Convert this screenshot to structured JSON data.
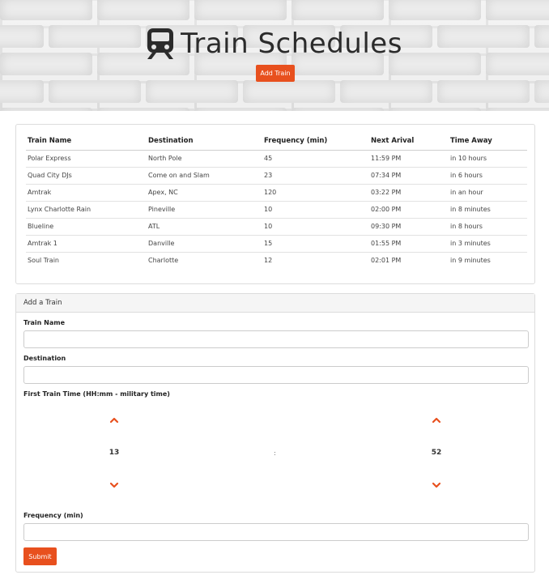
{
  "header": {
    "title": "Train Schedules",
    "icon": "train-icon",
    "add_train_label": "Add Train"
  },
  "schedule": {
    "columns": [
      "Train Name",
      "Destination",
      "Frequency (min)",
      "Next Arival",
      "Time Away"
    ],
    "rows": [
      [
        "Polar Express",
        "North Pole",
        "45",
        "11:59 PM",
        "in 10 hours"
      ],
      [
        "Quad City DJs",
        "Come on and Slam",
        "23",
        "07:34 PM",
        "in 6 hours"
      ],
      [
        "Amtrak",
        "Apex, NC",
        "120",
        "03:22 PM",
        "in an hour"
      ],
      [
        "Lynx Charlotte Rain",
        "Pineville",
        "10",
        "02:00 PM",
        "in 8 minutes"
      ],
      [
        "Blueline",
        "ATL",
        "10",
        "09:30 PM",
        "in 8 hours"
      ],
      [
        "Amtrak 1",
        "Danville",
        "15",
        "01:55 PM",
        "in 3 minutes"
      ],
      [
        "Soul Train",
        "Charlotte",
        "12",
        "02:01 PM",
        "in 9 minutes"
      ]
    ]
  },
  "form": {
    "heading": "Add a Train",
    "train_name_label": "Train Name",
    "train_name_value": "",
    "destination_label": "Destination",
    "destination_value": "",
    "first_time_label": "First Train Time (HH:mm - military time)",
    "hour": "13",
    "separator": ":",
    "minute": "52",
    "frequency_label": "Frequency (min)",
    "frequency_value": "",
    "submit_label": "Submit"
  },
  "colors": {
    "accent": "#e8501e",
    "title_text": "#2b2b2b"
  }
}
